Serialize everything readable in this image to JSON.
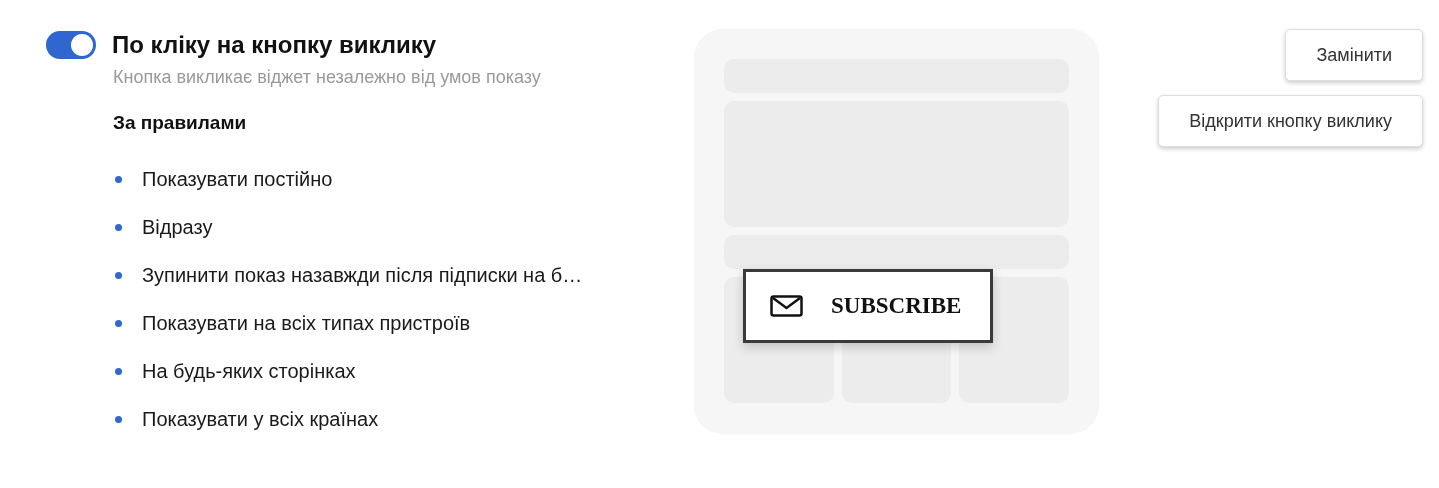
{
  "trigger": {
    "on": true,
    "title": "По кліку на кнопку виклику",
    "subtitle": "Кнопка викликає віджет незалежно від умов показу"
  },
  "rules_heading": "За правилами",
  "rules": [
    "Показувати постійно",
    "Відразу",
    "Зупинити показ назавжди після підписки на б…",
    "Показувати на всіх типах пристроїв",
    "На будь-яких сторінках",
    "Показувати у всіх країнах"
  ],
  "preview": {
    "button_label": "SUBSCRIBE"
  },
  "buttons": [
    "Замінити",
    "Відкрити кнопку виклику"
  ]
}
